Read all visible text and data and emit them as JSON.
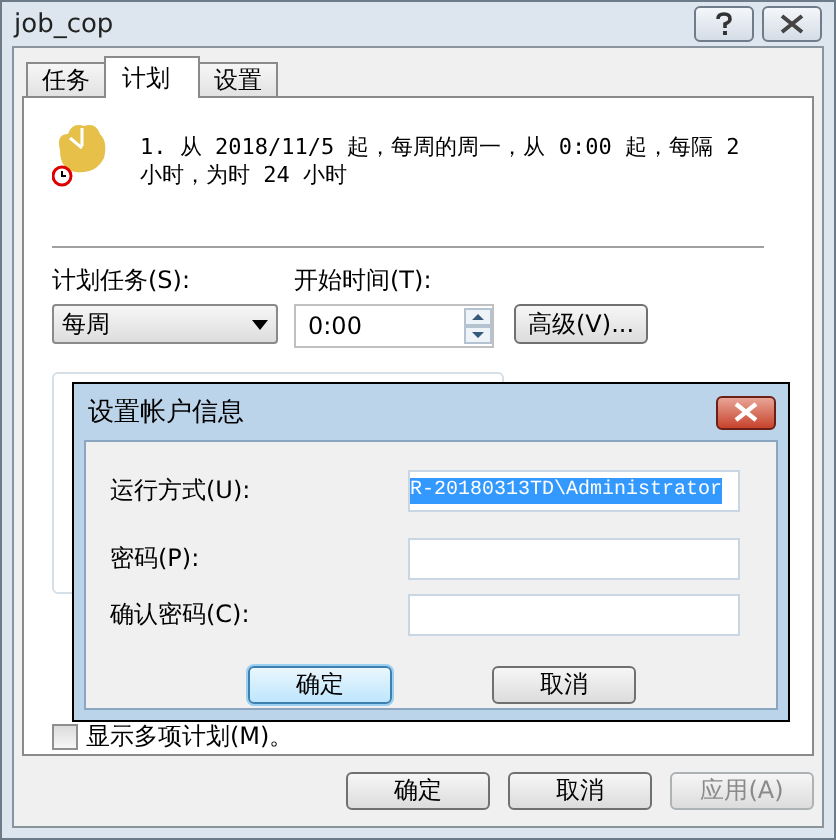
{
  "window": {
    "title": "job_cop"
  },
  "tabs": [
    {
      "label": "任务",
      "selected": false
    },
    {
      "label": "计划",
      "selected": true
    },
    {
      "label": "设置",
      "selected": false
    }
  ],
  "schedule_summary": "1. 从 2018/11/5 起，每周的周一，从 0:00 起，每隔 2 小时，为时 24 小时",
  "schedule_type": {
    "label": "计划任务(S):",
    "value": "每周"
  },
  "start_time": {
    "label": "开始时间(T):",
    "value": "0:00"
  },
  "advanced_button": "高级(V)...",
  "show_multiple": {
    "label": "显示多项计划(M)。",
    "checked": false
  },
  "dialog": {
    "title": "设置帐户信息",
    "fields": [
      {
        "label": "运行方式(U):",
        "value": "R-20180313TD\\Administrator",
        "text_selected": true
      },
      {
        "label": "密码(P):"
      },
      {
        "label": "确认密码(C):"
      }
    ],
    "buttons": [
      {
        "label": "确定",
        "focused": true
      },
      {
        "label": "取消",
        "focused": false
      }
    ]
  },
  "buttons": [
    {
      "label": "确定",
      "disabled": false
    },
    {
      "label": "取消",
      "disabled": false
    },
    {
      "label": "应用(A)",
      "disabled": true
    }
  ]
}
